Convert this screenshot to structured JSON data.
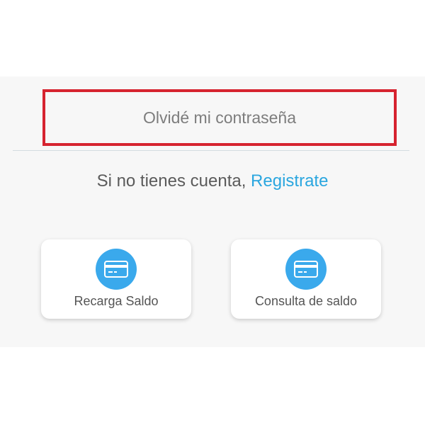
{
  "login": {
    "forgot_password": "Olvidé mi contraseña",
    "register_prompt": "Si no tienes cuenta,",
    "register_link": "Registrate"
  },
  "actions": [
    {
      "label": "Recarga Saldo",
      "icon": "credit-card-icon"
    },
    {
      "label": "Consulta de saldo",
      "icon": "credit-card-icon"
    }
  ],
  "colors": {
    "highlight_border": "#d6232f",
    "link_blue": "#2aa6df",
    "icon_circle": "#3aa9ec",
    "background": "#f7f7f7"
  }
}
